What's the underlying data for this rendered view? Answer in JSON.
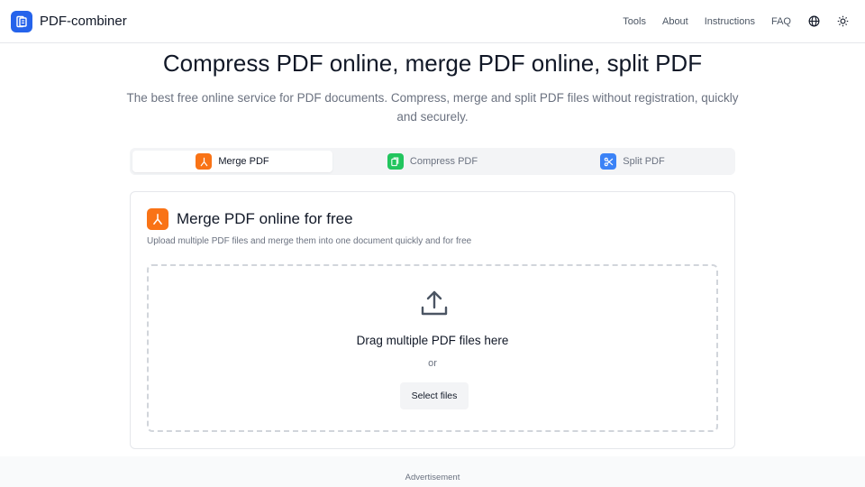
{
  "header": {
    "brand_name": "PDF-combiner",
    "nav": [
      "Tools",
      "About",
      "Instructions",
      "FAQ"
    ]
  },
  "hero": {
    "title": "Compress PDF online, merge PDF online, split PDF",
    "subtitle": "The best free online service for PDF documents. Compress, merge and split PDF files without registration, quickly and securely."
  },
  "tabs": [
    {
      "label": "Merge PDF",
      "icon": "merge-icon",
      "color": "#f97316",
      "active": true
    },
    {
      "label": "Compress PDF",
      "icon": "compress-icon",
      "color": "#22c55e",
      "active": false
    },
    {
      "label": "Split PDF",
      "icon": "scissors-icon",
      "color": "#3b82f6",
      "active": false
    }
  ],
  "card": {
    "title": "Merge PDF online for free",
    "description": "Upload multiple PDF files and merge them into one document quickly and for free",
    "drop_text": "Drag multiple PDF files here",
    "or_text": "or",
    "select_label": "Select files"
  },
  "footer": {
    "ad_label": "Advertisement"
  },
  "colors": {
    "brand": "#2563eb",
    "merge": "#f97316",
    "compress": "#22c55e",
    "split": "#3b82f6"
  }
}
